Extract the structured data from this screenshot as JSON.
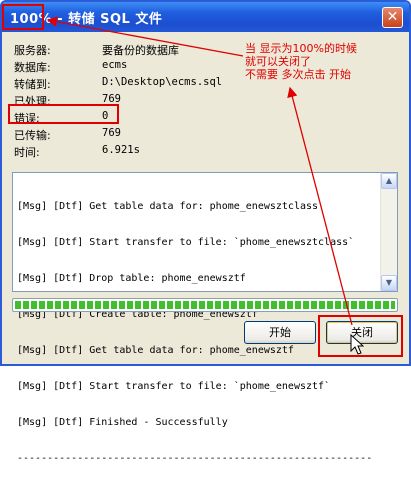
{
  "window": {
    "title": "100% - 转储 SQL 文件",
    "close_glyph": "✕"
  },
  "info": [
    {
      "label": "服务器:",
      "value": "要备份的数据库"
    },
    {
      "label": "数据库:",
      "value": "ecms"
    },
    {
      "label": "转储到:",
      "value": "D:\\Desktop\\ecms.sql"
    },
    {
      "label": "已处理:",
      "value": "769"
    },
    {
      "label": "错误:",
      "value": "0"
    },
    {
      "label": "已传输:",
      "value": "769"
    },
    {
      "label": "时间:",
      "value": "6.921s"
    }
  ],
  "annotation": {
    "lines": [
      "当  显示为100%的时候",
      "就可以关闭了",
      "不需要  多次点击  开始"
    ],
    "color": "#e00000"
  },
  "log": [
    "[Msg] [Dtf] Get table data for: phome_enewsztclass",
    "[Msg] [Dtf] Start transfer to file: `phome_enewsztclass`",
    "[Msg] [Dtf] Drop table: phome_enewsztf",
    "[Msg] [Dtf] Create table: phome_enewsztf",
    "[Msg] [Dtf] Get table data for: phome_enewsztf",
    "[Msg] [Dtf] Start transfer to file: `phome_enewsztf`",
    "[Msg] [Dtf] Finished - Successfully",
    "-----------------------------------------------------------"
  ],
  "progress": {
    "percent": 100,
    "color": "#3fbf2a"
  },
  "buttons": {
    "start": "开始",
    "close": "关闭"
  },
  "icons": {
    "scroll_up": "▲",
    "scroll_down": "▼"
  }
}
